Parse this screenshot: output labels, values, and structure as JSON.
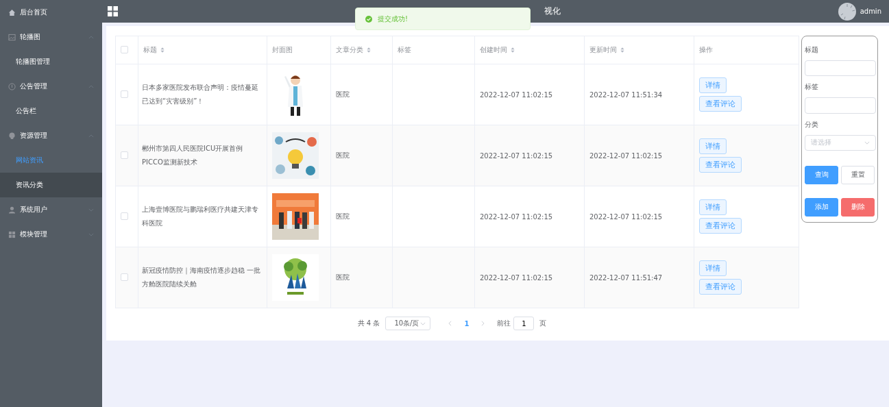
{
  "sidebar": {
    "items": [
      {
        "label": "后台首页"
      },
      {
        "label": "轮播图",
        "expanded": true,
        "children": [
          {
            "label": "轮播图管理",
            "selected": false,
            "hovered": false
          }
        ]
      },
      {
        "label": "公告管理",
        "expanded": true,
        "children": [
          {
            "label": "公告栏",
            "selected": false,
            "hovered": false
          }
        ]
      },
      {
        "label": "资源管理",
        "expanded": true,
        "children": [
          {
            "label": "网站资讯",
            "selected": true,
            "hovered": false
          },
          {
            "label": "资讯分类",
            "selected": false,
            "hovered": true
          }
        ]
      },
      {
        "label": "系统用户",
        "expanded": false
      },
      {
        "label": "模块管理",
        "expanded": false
      }
    ]
  },
  "header": {
    "title": "视化",
    "username": "admin"
  },
  "toast": {
    "message": "提交成功!"
  },
  "table": {
    "all_checked": false,
    "columns": [
      {
        "label": "标题",
        "sortable": true
      },
      {
        "label": "封面图",
        "sortable": false
      },
      {
        "label": "文章分类",
        "sortable": true
      },
      {
        "label": "标签",
        "sortable": false
      },
      {
        "label": "创建时间",
        "sortable": true
      },
      {
        "label": "更新时间",
        "sortable": true
      },
      {
        "label": "操作",
        "sortable": false
      }
    ],
    "rows": [
      {
        "checked": false,
        "title": "日本多家医院发布联合声明：疫情蔓延已达到“灾害级别”！",
        "category": "医院",
        "created": "2022-12-07 11:02:15",
        "updated": "2022-12-07 11:51:34",
        "actions": [
          "详情",
          "查看评论"
        ]
      },
      {
        "checked": false,
        "title": "郴州市第四人民医院ICU开展首例PICCO监测新技术",
        "category": "医院",
        "created": "2022-12-07 11:02:15",
        "updated": "2022-12-07 11:02:15",
        "actions": [
          "详情",
          "查看评论"
        ]
      },
      {
        "checked": false,
        "title": "上海壹博医院与鹏瑞利医疗共建天津专科医院",
        "category": "医院",
        "created": "2022-12-07 11:02:15",
        "updated": "2022-12-07 11:02:15",
        "actions": [
          "详情",
          "查看评论"
        ]
      },
      {
        "checked": false,
        "title": "新冠疫情防控｜海南疫情逐步趋稳 一批方舱医院陆续关舱",
        "category": "医院",
        "created": "2022-12-07 11:02:15",
        "updated": "2022-12-07 11:51:47",
        "actions": [
          "详情",
          "查看评论"
        ]
      }
    ]
  },
  "pagination": {
    "total": "共 4 条",
    "page_size": "10条/页",
    "pages": [
      {
        "label": "1",
        "selected": true
      }
    ],
    "goto_label": "前往",
    "goto_value": "1",
    "page_suffix": "页"
  },
  "search_panel": {
    "fields": [
      {
        "label": "标题",
        "kind": "text"
      },
      {
        "label": "标签",
        "kind": "text"
      },
      {
        "label": "分类",
        "kind": "select",
        "placeholder": "请选择"
      }
    ],
    "buttons": [
      {
        "label": "查询",
        "kind": "primary"
      },
      {
        "label": "重置",
        "kind": "default"
      },
      {
        "label": "添加",
        "kind": "primary"
      },
      {
        "label": "删除",
        "kind": "danger"
      }
    ]
  }
}
